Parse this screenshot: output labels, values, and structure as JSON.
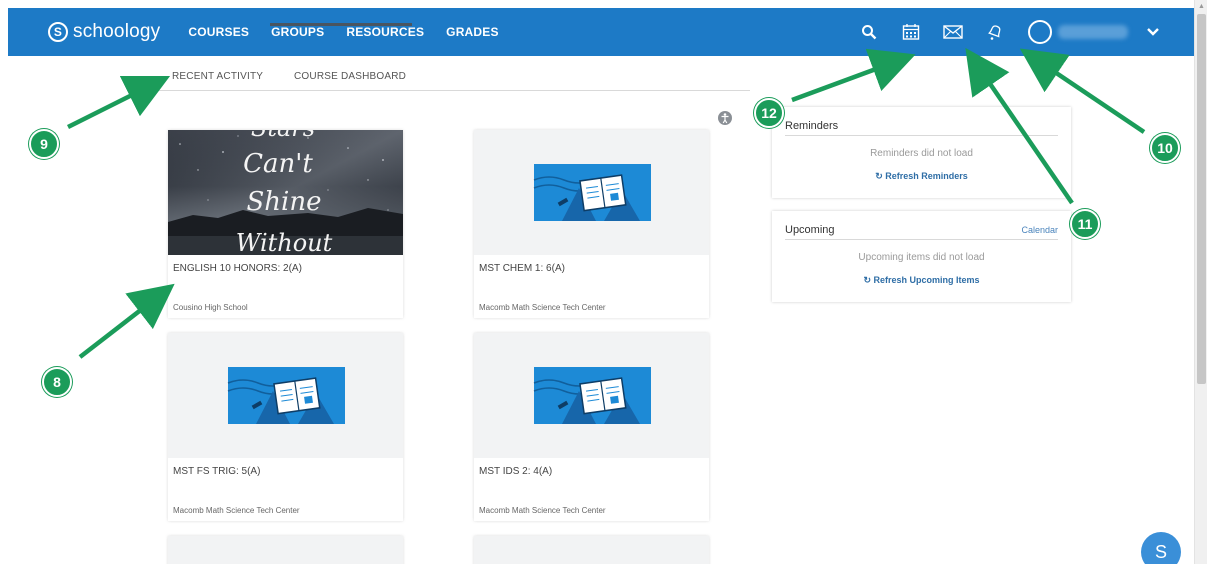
{
  "brand": "schoology",
  "nav": {
    "courses": "COURSES",
    "groups": "GROUPS",
    "resources": "RESOURCES",
    "grades": "GRADES"
  },
  "icons": {
    "search": "search-icon",
    "calendar": "calendar-icon",
    "messages": "envelope-icon",
    "notifications": "bell-icon",
    "profile": "user-avatar",
    "menu": "chevron-down-icon"
  },
  "tabs": {
    "recent": "RECENT ACTIVITY",
    "dashboard": "COURSE DASHBOARD"
  },
  "courses": [
    {
      "title": "ENGLISH 10 HONORS: 2(A)",
      "school": "Cousino High School",
      "image_text": [
        "Stars",
        "Can't",
        "Shine",
        "Without"
      ]
    },
    {
      "title": "MST CHEM 1: 6(A)",
      "school": "Macomb Math Science Tech Center"
    },
    {
      "title": "MST FS TRIG: 5(A)",
      "school": "Macomb Math Science Tech Center"
    },
    {
      "title": "MST IDS 2: 4(A)",
      "school": "Macomb Math Science Tech Center"
    }
  ],
  "reminders": {
    "title": "Reminders",
    "message": "Reminders did not load",
    "refresh": "Refresh Reminders"
  },
  "upcoming": {
    "title": "Upcoming",
    "calendar_link": "Calendar",
    "message": "Upcoming items did not load",
    "refresh": "Refresh Upcoming Items"
  },
  "callouts": {
    "c8": "8",
    "c9": "9",
    "c10": "10",
    "c11": "11",
    "c12": "12"
  },
  "fab": "S",
  "colors": {
    "nav_bg": "#1d7ac6",
    "callout_green": "#1b9c5a",
    "link_blue": "#2f6ea6"
  }
}
